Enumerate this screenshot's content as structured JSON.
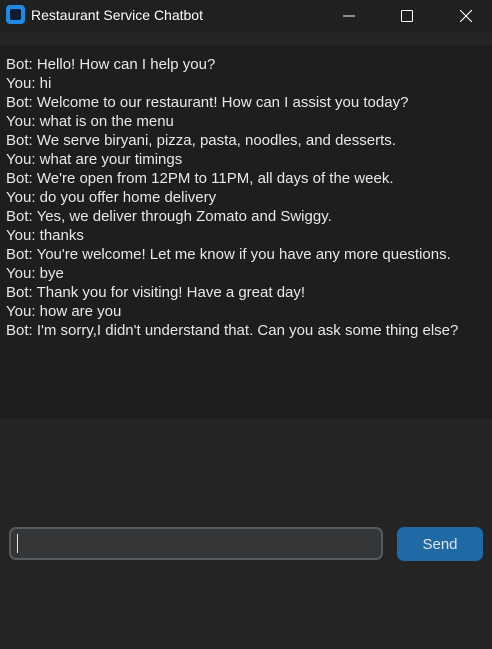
{
  "window": {
    "title": "Restaurant Service Chatbot",
    "controls": {
      "minimize_icon": "minimize-icon",
      "maximize_icon": "maximize-icon",
      "close_icon": "close-icon"
    }
  },
  "chat": {
    "messages": [
      "Bot: Hello! How can I help you?",
      "You: hi",
      "Bot: Welcome to our restaurant! How can I assist you today?",
      "You: what is on the menu",
      "Bot: We serve biryani, pizza, pasta, noodles, and desserts.",
      "You: what are your timings",
      "Bot: We're open from 12PM to 11PM, all days of the week.",
      "You: do you offer home delivery",
      "Bot: Yes, we deliver through Zomato and Swiggy.",
      "You: thanks",
      "Bot: You're welcome! Let me know if you have any more questions.",
      "You: bye",
      "Bot: Thank you for visiting! Have a great day!",
      "You: how are you",
      "Bot: I'm sorry,I didn't understand that. Can you ask some thing else?"
    ]
  },
  "input": {
    "value": "",
    "placeholder": ""
  },
  "send_button": {
    "label": "Send"
  },
  "colors": {
    "background": "#242424",
    "chat_background": "#1d1e1e",
    "accent": "#1f6aa5",
    "text": "#e8e8e8"
  }
}
